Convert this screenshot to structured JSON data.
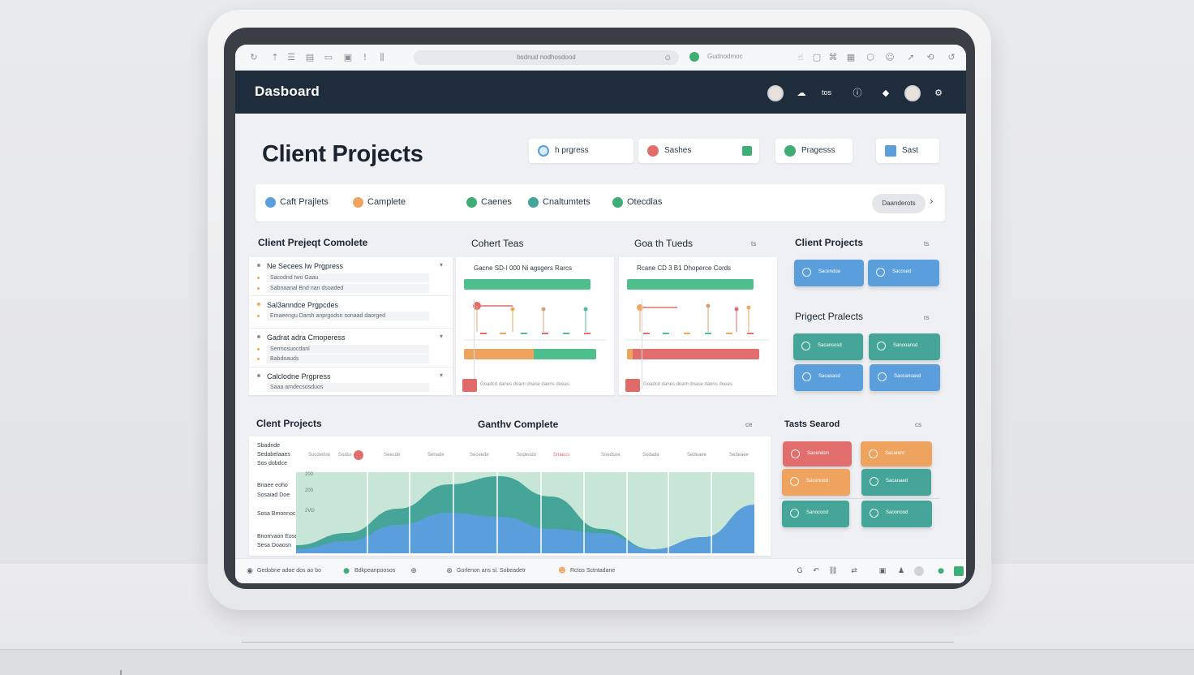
{
  "browser": {
    "address": "bsdnud nodhosdood",
    "site_label": "Gudnodmoc"
  },
  "header": {
    "title": "Dasboard",
    "text_item": "tos"
  },
  "page": {
    "title": "Client Projects"
  },
  "filters": [
    {
      "label": "h prgress",
      "color": "#5a9fdc"
    },
    {
      "label": "Sashes",
      "color": "#e26d6d"
    },
    {
      "label": "Pragesss",
      "color": "#3fae76"
    },
    {
      "label": "Sast",
      "color": "#5a9fdc"
    }
  ],
  "tabs": [
    {
      "label": "Caft Prajlets",
      "color": "#5a9fdc"
    },
    {
      "label": "Camplete",
      "color": "#eea35e"
    },
    {
      "label": "Caenes",
      "color": "#3fae76"
    },
    {
      "label": "Cnaltumtets",
      "color": "#45a598"
    },
    {
      "label": "Otecdlas",
      "color": "#3fae76"
    }
  ],
  "tabs_button": "Daanderots",
  "sections": {
    "list_title": "Client Prejeqt Comolete",
    "chart1_title": "Cohert Teas",
    "chart2_title": "Goa th Tueds",
    "chart2_badge": "ts",
    "right1_title": "Client Projects",
    "right1_badge": "ts",
    "right2_title": "Prigect Pralects",
    "right2_badge": "rs",
    "area_left_title": "Clent Projects",
    "area_center_title": "Ganthv Complete",
    "area_badge": "ce",
    "task_title": "Tasts Searod",
    "task_badge": "cs"
  },
  "list_groups": [
    {
      "title": "Ne Secees Iw Prgpress",
      "subs": [
        "Sacodnd Iwo Gaau",
        "Sabnaanal Bnd nan dsoaded"
      ]
    },
    {
      "title": "Sal3anndce Prgpcdes",
      "subs": [
        "Emaeengu Darsh anprgodsn sonaad daorged"
      ]
    },
    {
      "title": "Gadrat adra Cmoperess",
      "subs": [
        "Sermosuocdanl",
        "Babdoauds"
      ]
    },
    {
      "title": "Calclodne Prgpress",
      "subs": [
        "Saaa amdecsosduos"
      ]
    }
  ],
  "mini_cards": [
    {
      "header": "Gacne SD-I 000 Ni agsgers Rarcs",
      "footer": "Goadcd  danes  doam  dnase  daons  doeas",
      "progress_a": 0.96,
      "progress_b_left": 0.53,
      "progress_b_right": 0.47,
      "color_a": "#4fc08d",
      "color_b_left": "#eea35e",
      "color_b_right": "#4fc08d"
    },
    {
      "header": "Rcane CD 3 B1 Dhoperce Cords",
      "footer": "Goadcd  danes  doam  dnase  daons  doeas",
      "progress_a": 0.96,
      "progress_b_left": 0.04,
      "progress_b_right": 0.96,
      "color_a": "#4fc08d",
      "color_b_left": "#eea35e",
      "color_b_right": "#e26d6d"
    }
  ],
  "right_tiles_1": [
    {
      "label": "Sacendoa",
      "color": "blue"
    },
    {
      "label": "Sacosed",
      "color": "blue"
    }
  ],
  "right_tiles_2": [
    {
      "label": "Sacansosd",
      "color": "teal"
    },
    {
      "label": "Sanooansd",
      "color": "teal"
    },
    {
      "label": "Sacaoasd",
      "color": "blue"
    },
    {
      "label": "Saocanoasd",
      "color": "blue"
    }
  ],
  "task_tiles": [
    {
      "label": "Sacendon",
      "color": "red"
    },
    {
      "label": "Sacarerd",
      "color": "orange"
    },
    {
      "label": "Sacenood",
      "color": "orange"
    },
    {
      "label": "Sacanaed",
      "color": "teal"
    },
    {
      "label": "Sanocood",
      "color": "teal"
    },
    {
      "label": "Saoonood",
      "color": "teal"
    }
  ],
  "area_labels": [
    "Sbadnde",
    "Sedabelaaes",
    "Sos dobdce",
    "Bnaee eoho",
    "Sosaiad Doe",
    "Sosa Bmonnocs",
    "Bnorrvaon Eose",
    "Sesa Doaosn"
  ],
  "area_columns": [
    "Socdedoe",
    "Sodss",
    "Seecde",
    "Senade",
    "Seceede",
    "Sodeodo",
    "Snaecs",
    "Soedsoe",
    "Sodade",
    "Sedeaee"
  ],
  "area_ticks": [
    "200",
    "200",
    "2VD"
  ],
  "chart_data": {
    "type": "area",
    "series": [
      {
        "values": [
          0.1,
          0.25,
          0.55,
          0.85,
          0.95,
          0.7,
          0.3,
          0.05,
          0.15,
          0.55
        ],
        "color": "#45a598"
      },
      {
        "values": [
          0.05,
          0.15,
          0.35,
          0.5,
          0.45,
          0.3,
          0.25,
          0.05,
          0.2,
          0.6
        ],
        "color": "#5a9fdc"
      }
    ],
    "background_color": "#c8e6d8"
  },
  "status_bar": {
    "item1": "Gedobne adoe dos ao bo",
    "item2": "Bdkpeanpoosos",
    "item3": "Gorlenon ans sl. Sobeadetr",
    "item4": "Rctos Sctntadane"
  }
}
